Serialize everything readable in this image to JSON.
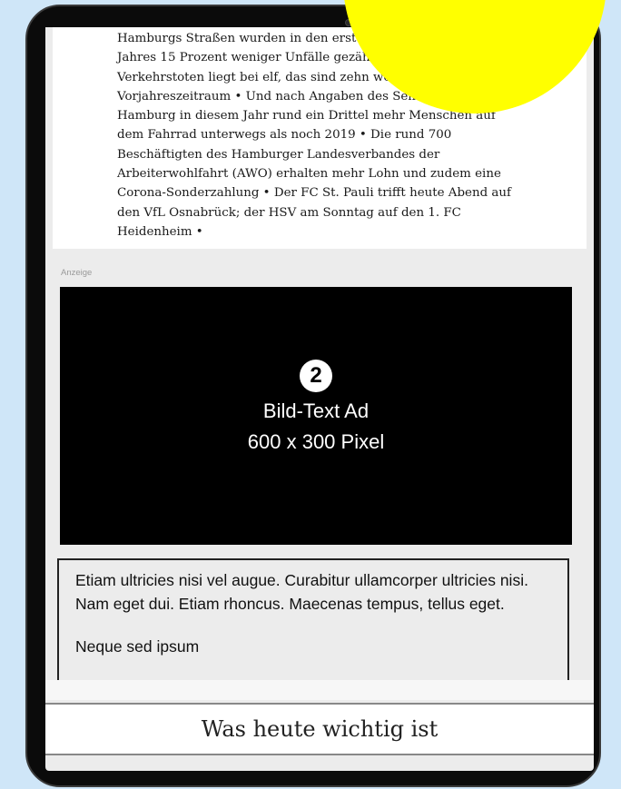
{
  "article": {
    "lines": [
      "Hamburgs Straßen wurden in den ersten neun Monaten dieses",
      "Jahres 15 Prozent weniger Unfälle gezählt • Die Zahl der",
      "Verkehrstoten liegt bei elf, das sind zehn weniger als im",
      "Vorjahreszeitraum • Und nach Angaben des Senats waren in",
      "Hamburg in diesem Jahr rund ein Drittel mehr Menschen auf",
      "dem Fahrrad unterwegs als noch 2019 • Die rund 700",
      "Beschäftigten des Hamburger Landesverbandes der",
      "Arbeiterwohlfahrt (AWO) erhalten mehr Lohn und zudem eine",
      "Corona-Sonderzahlung • Der FC St. Pauli trifft heute Abend auf",
      "den VfL Osnabrück; der HSV am Sonntag auf den 1. FC",
      "Heidenheim •"
    ]
  },
  "ad": {
    "label": "Anzeige",
    "badge": "2",
    "line1": "Bild-Text Ad",
    "line2": "600 x 300 Pixel"
  },
  "lorem": {
    "paragraph1": "Etiam ultricies nisi vel augue. Curabitur ullamcorper ultricies nisi. Nam eget dui. Etiam rhoncus. Maecenas tempus, tellus eget.",
    "paragraph2": "Neque sed ipsum"
  },
  "bottom_bar": {
    "title": "Was heute wichtig ist"
  },
  "colors": {
    "background": "#cfe6f8",
    "highlight": "#ffff00",
    "ad_background": "#000000"
  }
}
